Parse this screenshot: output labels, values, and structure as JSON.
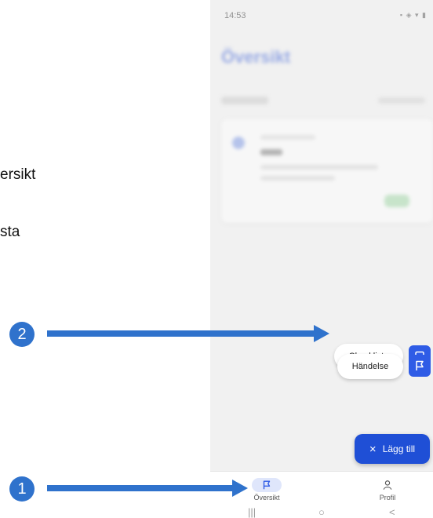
{
  "left_text": [
    "ersikt",
    "sta"
  ],
  "status_bar": {
    "time": "14:53"
  },
  "blurred_content": {
    "title": "Översikt"
  },
  "fab_menu": {
    "checklist_label": "Checklista",
    "event_label": "Händelse",
    "add_label": "Lägg till",
    "add_icon": "×"
  },
  "bottom_nav": {
    "items": [
      {
        "label": "Översikt",
        "icon": "flag-icon"
      },
      {
        "label": "Profil",
        "icon": "person-icon"
      }
    ]
  },
  "system_nav": {
    "recents": "|||",
    "home": "○",
    "back": "<"
  },
  "annotations": {
    "marker_1": "1",
    "marker_2": "2",
    "color": "#2f72cc"
  }
}
